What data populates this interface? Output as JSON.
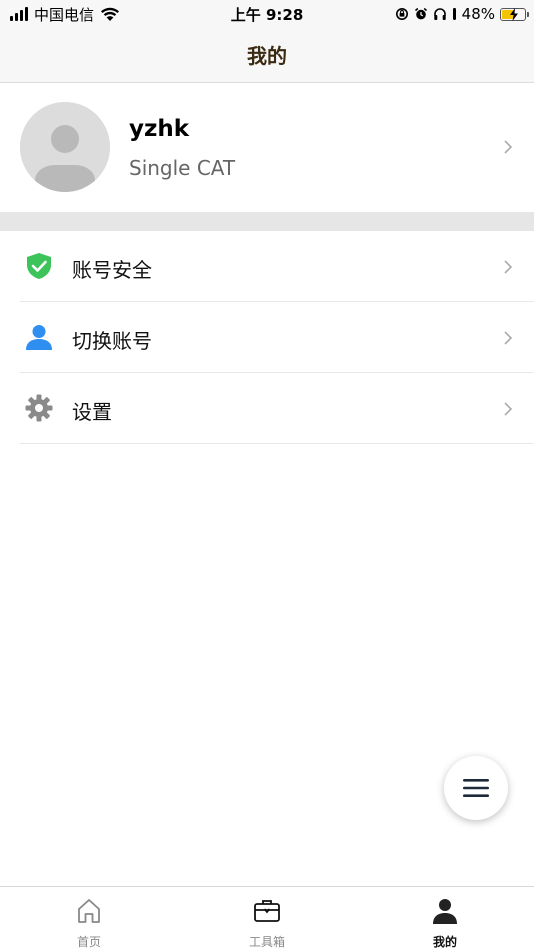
{
  "status_bar": {
    "carrier": "中国电信",
    "time": "上午 9:28",
    "battery": "48%",
    "battery_level": 0.48
  },
  "nav": {
    "title": "我的"
  },
  "profile": {
    "name": "yzhk",
    "subtitle": "Single CAT"
  },
  "menu": {
    "items": [
      {
        "label": "账号安全",
        "icon": "shield-check-icon"
      },
      {
        "label": "切换账号",
        "icon": "user-icon"
      },
      {
        "label": "设置",
        "icon": "gear-icon"
      }
    ]
  },
  "tabs": [
    {
      "label": "首页",
      "icon": "home-icon",
      "active": false
    },
    {
      "label": "工具箱",
      "icon": "toolbox-icon",
      "active": false
    },
    {
      "label": "我的",
      "icon": "person-icon",
      "active": true
    }
  ],
  "colors": {
    "accent_green": "#3cc45a",
    "user_blue": "#2f8ff0",
    "title_brown": "#3b2a12",
    "battery_yellow": "#f5c400"
  }
}
